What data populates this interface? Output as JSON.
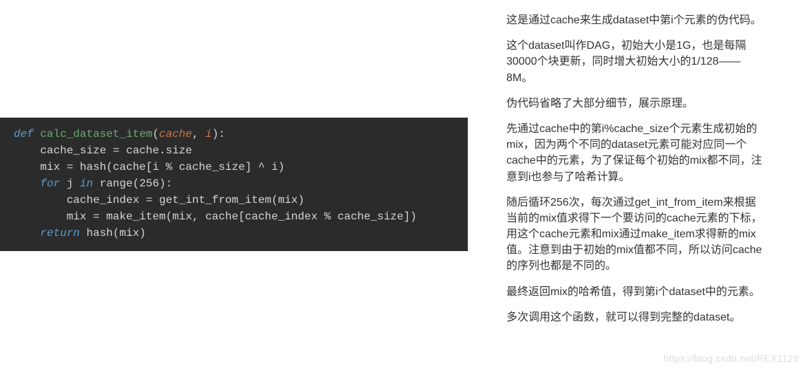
{
  "code": {
    "line1_def": "def",
    "line1_fn": " calc_dataset_item",
    "line1_paren_open": "(",
    "line1_param1": "cache",
    "line1_comma": ", ",
    "line1_param2": "i",
    "line1_paren_close": "):",
    "line2": "    cache_size = cache.size",
    "line3_a": "    mix = hash(cache[i ",
    "line3_b": "%",
    "line3_c": " cache_size] ^ i)",
    "line4_for": "    for",
    "line4_j": " j ",
    "line4_in": "in",
    "line4_range": " range(",
    "line4_num": "256",
    "line4_close": "):",
    "line5": "        cache_index = get_int_from_item(mix)",
    "line6_a": "        mix = make_item(mix, cache[cache_index ",
    "line6_b": "%",
    "line6_c": " cache_size])",
    "line7_return": "    return",
    "line7_rest": " hash(mix)"
  },
  "paragraphs": {
    "p1": "这是通过cache来生成dataset中第i个元素的伪代码。",
    "p2": "这个dataset叫作DAG，初始大小是1G，也是每隔30000个块更新，同时增大初始大小的1/128——8M。",
    "p3": "伪代码省略了大部分细节，展示原理。",
    "p4": "先通过cache中的第i%cache_size个元素生成初始的mix，因为两个不同的dataset元素可能对应同一个cache中的元素，为了保证每个初始的mix都不同，注意到i也参与了哈希计算。",
    "p5": "随后循环256次，每次通过get_int_from_item来根据当前的mix值求得下一个要访问的cache元素的下标，用这个cache元素和mix通过make_item求得新的mix值。注意到由于初始的mix值都不同，所以访问cache的序列也都是不同的。",
    "p6": "最终返回mix的哈希值，得到第i个dataset中的元素。",
    "p7": "多次调用这个函数，就可以得到完整的dataset。"
  },
  "watermark": "https://blog.csdn.net/REX1129"
}
